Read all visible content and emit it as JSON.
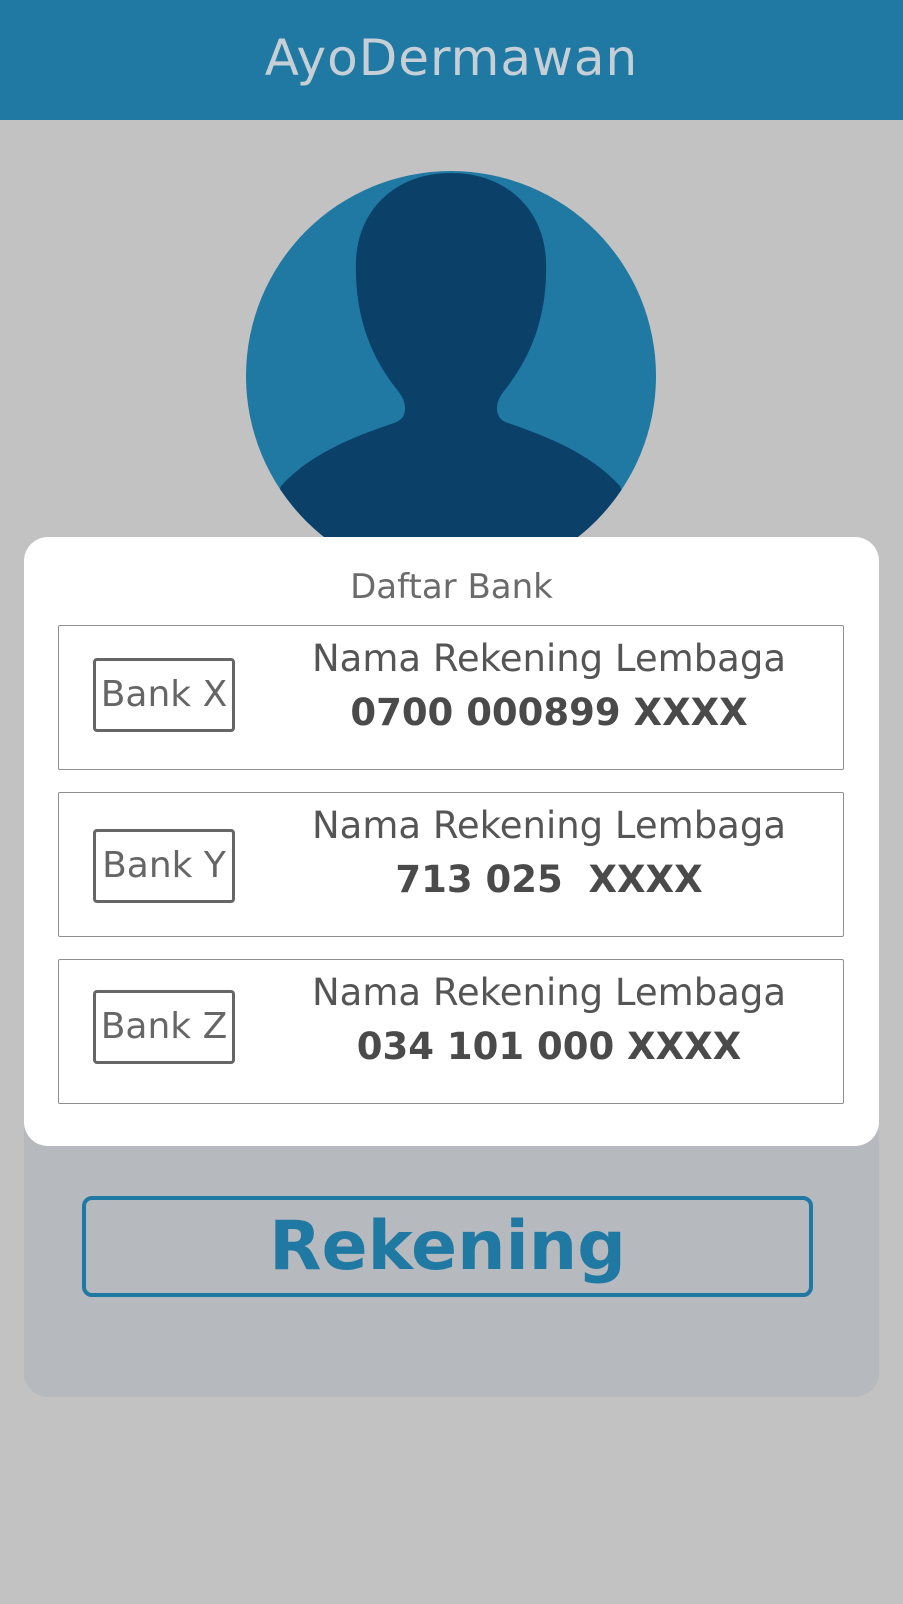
{
  "app": {
    "title": "AyoDermawan"
  },
  "colors": {
    "header": "#1f79a3",
    "background": "#c2c2c3",
    "avatar_circle": "#1f79a3",
    "avatar_silhouette": "#0b4168",
    "accent": "#1f79a3"
  },
  "profile": {
    "avatar_icon": "user-silhouette-icon"
  },
  "bank_list": {
    "title": "Daftar Bank",
    "banks": [
      {
        "logo": "Bank X",
        "account_name": "Nama Rekening Lembaga",
        "account_number": "0700 000899 XXXX"
      },
      {
        "logo": "Bank Y",
        "account_name": "Nama Rekening Lembaga",
        "account_number": "713 025  XXXX"
      },
      {
        "logo": "Bank Z",
        "account_name": "Nama Rekening Lembaga",
        "account_number": "034 101 000 XXXX"
      }
    ]
  },
  "actions": {
    "rekening_label": "Rekening"
  }
}
